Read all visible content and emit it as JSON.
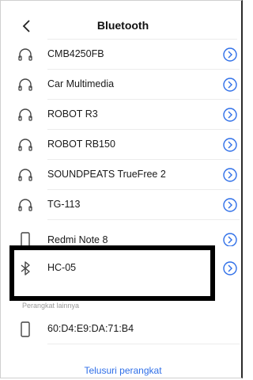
{
  "header": {
    "title": "Bluetooth",
    "back_icon": "chevron-left-icon"
  },
  "paired_devices": [
    {
      "name": "CMB4250FB",
      "icon": "headphones-icon"
    },
    {
      "name": "Car Multimedia",
      "icon": "headphones-icon"
    },
    {
      "name": "ROBOT  R3",
      "icon": "headphones-icon"
    },
    {
      "name": "ROBOT RB150",
      "icon": "headphones-icon"
    },
    {
      "name": "SOUNDPEATS TrueFree 2",
      "icon": "headphones-icon"
    },
    {
      "name": "TG-113",
      "icon": "headphones-icon"
    },
    {
      "name": "Redmi Note 8",
      "icon": "phone-icon"
    },
    {
      "name": "HC-05",
      "icon": "bluetooth-icon"
    }
  ],
  "other_devices_section": {
    "label": "Perangkat lainnya"
  },
  "other_devices": [
    {
      "name": "60:D4:E9:DA:71:B4",
      "icon": "phone-icon"
    }
  ],
  "footer": {
    "search_label": "Telusuri perangkat"
  },
  "colors": {
    "accent": "#2f6fe8",
    "highlight_border": "#000000"
  }
}
